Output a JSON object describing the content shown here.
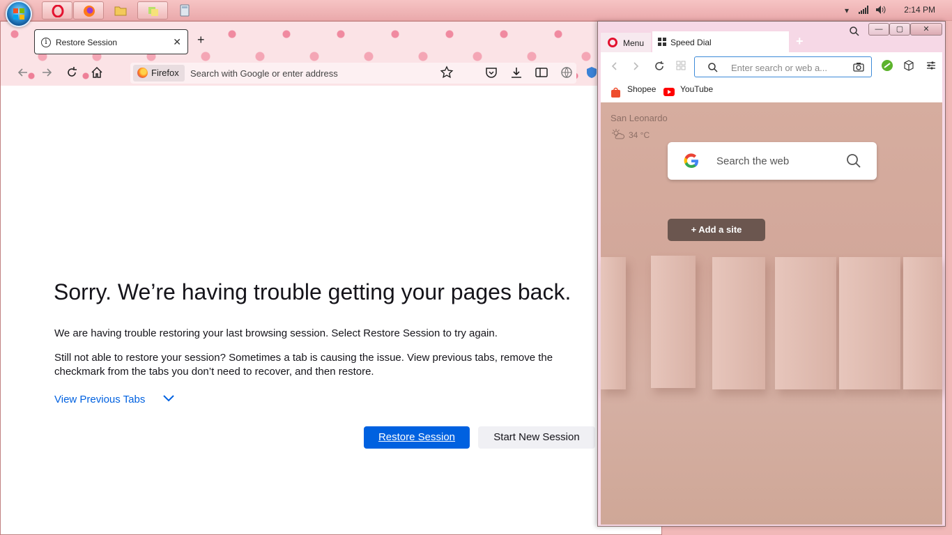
{
  "taskbar": {
    "clock": "2:14 PM",
    "buttons": [
      {
        "name": "opera",
        "icon": "opera-icon"
      },
      {
        "name": "firefox",
        "icon": "firefox-icon"
      },
      {
        "name": "explorer",
        "icon": "folder-icon"
      },
      {
        "name": "app",
        "icon": "sticky-notes-icon"
      },
      {
        "name": "calculator",
        "icon": "calculator-icon"
      }
    ]
  },
  "firefox": {
    "tab_label": "Restore Session",
    "new_tab": "+",
    "identity_label": "Firefox",
    "urlbar_placeholder": "Search with Google or enter address",
    "heading": "Sorry. We’re having trouble getting your pages back.",
    "para1": "We are having trouble restoring your last browsing session. Select Restore Session to try again.",
    "para2": "Still not able to restore your session? Sometimes a tab is causing the issue. View previous tabs, remove the checkmark from the tabs you don’t need to recover, and then restore.",
    "view_previous": "View Previous Tabs",
    "restore_button": "Restore Session",
    "new_session_button": "Start New Session",
    "colors": {
      "accent": "#0061e0"
    }
  },
  "opera": {
    "menu_label": "Menu",
    "tab_label": "Speed Dial",
    "address_placeholder": "Enter search or web a...",
    "bookmarks": [
      "Shopee",
      "YouTube"
    ],
    "weather_city": "San Leonardo",
    "weather_temp": "34 °C",
    "search_placeholder": "Search the web",
    "add_site": "+  Add a site"
  }
}
